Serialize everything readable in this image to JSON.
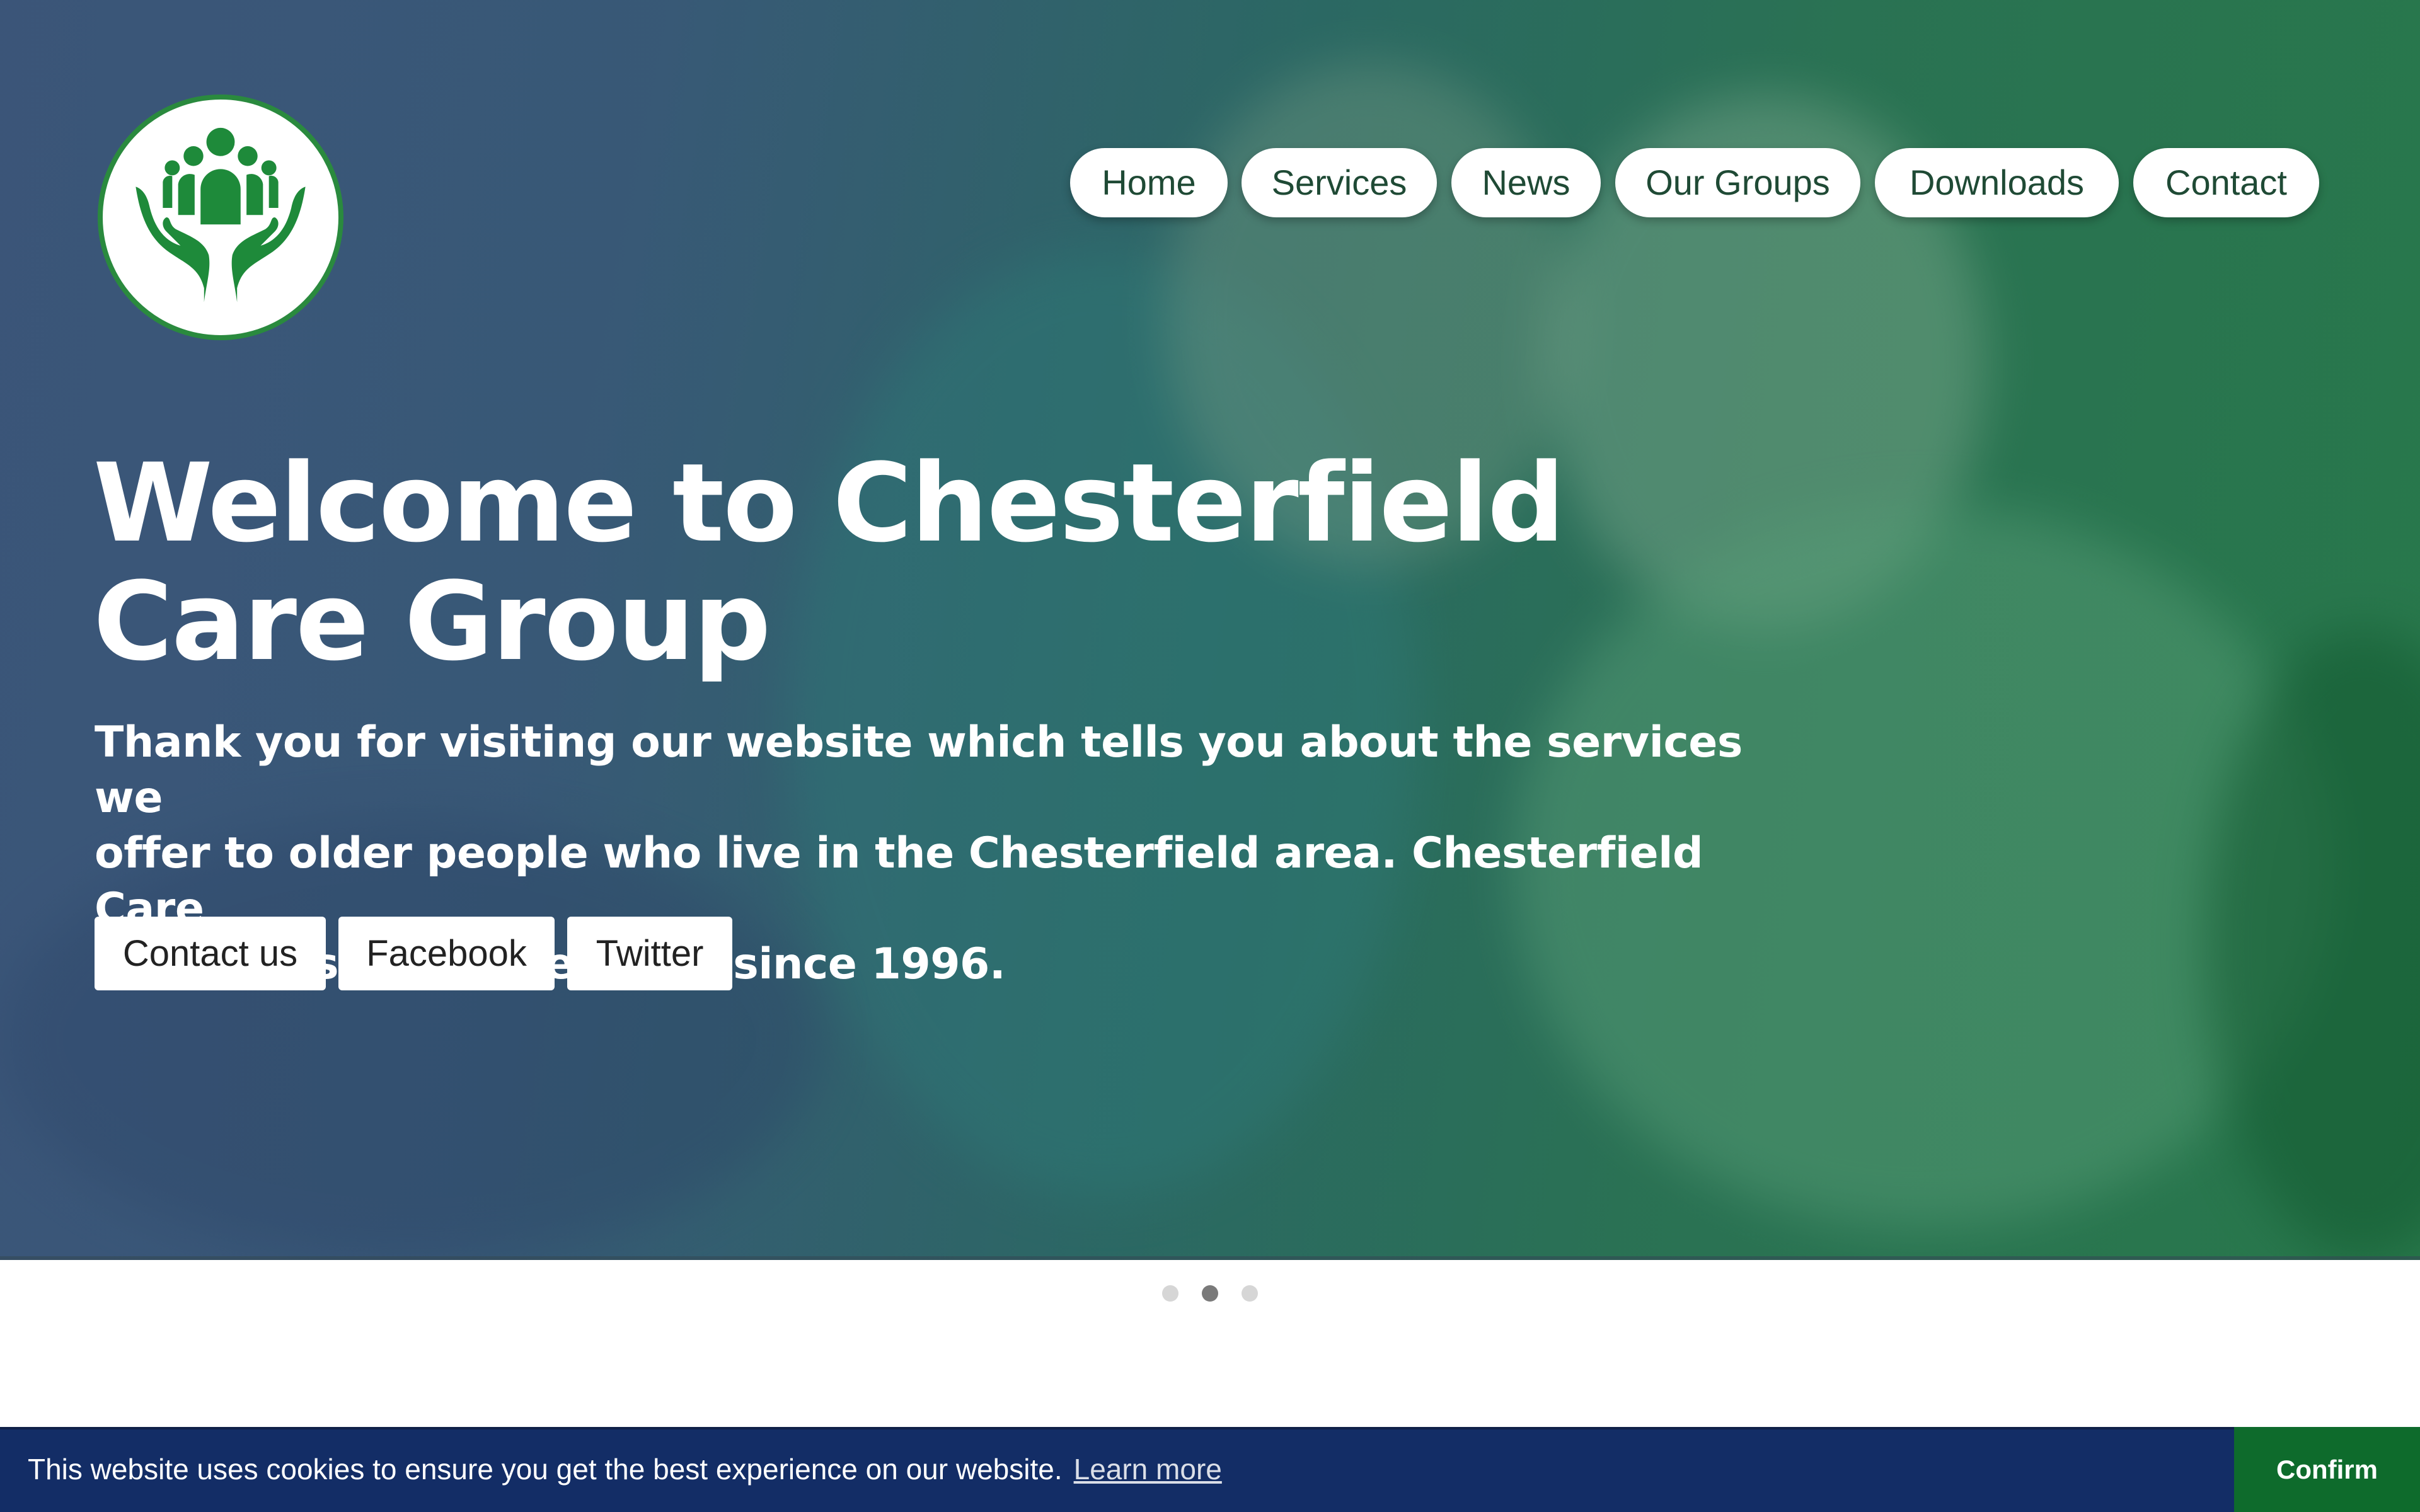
{
  "site": {
    "name": "Chesterfield Care Group",
    "logo_icon": "hands-holding-people-icon"
  },
  "nav": {
    "items": [
      {
        "label": "Home"
      },
      {
        "label": "Services"
      },
      {
        "label": "News"
      },
      {
        "label": "Our Groups"
      },
      {
        "label": "Downloads"
      },
      {
        "label": "Contact"
      }
    ]
  },
  "hero": {
    "title_line1": "Welcome to Chesterfield",
    "title_line2": "Care Group",
    "intro_line1": "Thank you for visiting our website which tells you about the services we",
    "intro_line2": "offer to older people who live in the Chesterfield area. Chesterfield Care",
    "intro_line3": "Group has been operating since 1996.",
    "buttons": [
      {
        "label": "Contact us"
      },
      {
        "label": "Facebook"
      },
      {
        "label": "Twitter"
      }
    ]
  },
  "carousel": {
    "slide_count": 3,
    "active_index": 1
  },
  "cookie_banner": {
    "message": "This website uses cookies to ensure you get the best experience on our website.",
    "learn_more": "Learn more",
    "confirm": "Confirm"
  },
  "colors": {
    "brand_green": "#2a8a3e",
    "nav_text": "#1f4a35",
    "cookie_bg": "#132d66",
    "confirm_bg": "#0e6b2c",
    "dot_active": "#7a7a7a",
    "dot_inactive": "#d6d6d6"
  }
}
